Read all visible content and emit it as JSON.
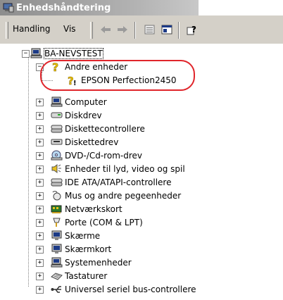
{
  "window": {
    "title": "Enhedshåndtering"
  },
  "menubar": {
    "handling_label": "Handling",
    "vis_label": "Vis"
  },
  "tree": {
    "root": "BA-NEVSTEST",
    "andre": "Andre enheder",
    "epson": "EPSON Perfection2450",
    "items": [
      "Computer",
      "Diskdrev",
      "Diskettecontrollere",
      "Diskettedrev",
      "DVD-/Cd-rom-drev",
      "Enheder til lyd, video og spil",
      "IDE ATA/ATAPI-controllere",
      "Mus og andre pegeenheder",
      "Netværkskort",
      "Porte (COM & LPT)",
      "Skærme",
      "Skærmkort",
      "Systemenheder",
      "Tastaturer",
      "Universel seriel bus-controllere"
    ]
  },
  "colors": {
    "highlight": "#e0252b",
    "titlebar": "#9a9a9a",
    "toolbar": "#d4d0c8"
  },
  "icons": [
    "computer-icon",
    "question-icon",
    "warning-device-icon",
    "disk-drive-icon",
    "controller-icon",
    "floppy-icon",
    "cdrom-icon",
    "speaker-icon",
    "mouse-icon",
    "network-icon",
    "port-icon",
    "monitor-icon",
    "keyboard-icon",
    "usb-icon"
  ]
}
